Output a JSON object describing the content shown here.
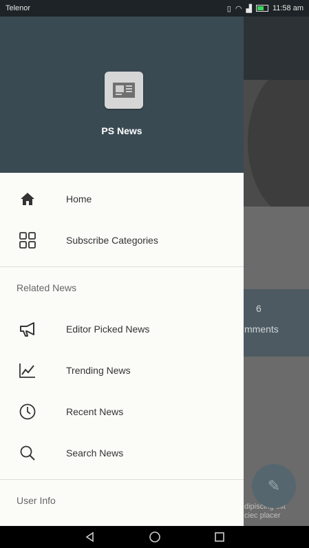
{
  "status_bar": {
    "carrier": "Telenor",
    "time": "11:58 am"
  },
  "drawer": {
    "app_name": "PS News",
    "menu": [
      {
        "label": "Home",
        "icon": "home-icon"
      },
      {
        "label": "Subscribe Categories",
        "icon": "grid-icon"
      }
    ],
    "related_news_title": "Related News",
    "related_items": [
      {
        "label": "Editor Picked News",
        "icon": "megaphone-icon"
      },
      {
        "label": "Trending News",
        "icon": "trending-icon"
      },
      {
        "label": "Recent News",
        "icon": "clock-icon"
      },
      {
        "label": "Search News",
        "icon": "search-icon"
      }
    ],
    "user_info_title": "User Info"
  },
  "background": {
    "comments_count": "6",
    "comments_label": "mments",
    "snippet_line1": "dipiscing elit",
    "snippet_line2": "ciec placer"
  },
  "colors": {
    "drawer_header": "#3a4a53",
    "drawer_bg": "#fbfbf8",
    "status_bar": "#1d2326"
  }
}
